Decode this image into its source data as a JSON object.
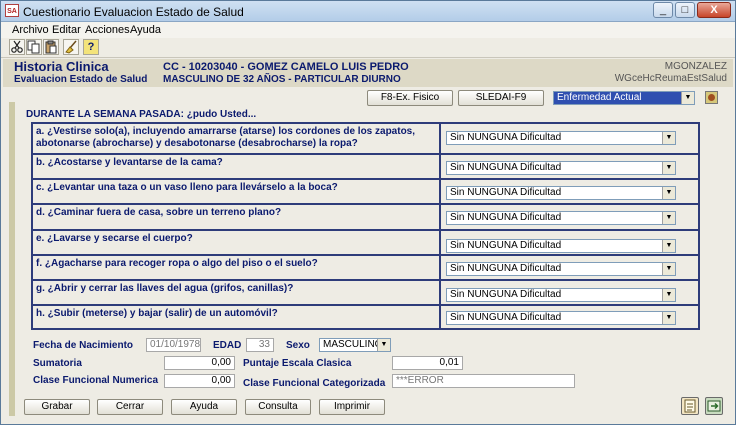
{
  "window": {
    "title": "Cuestionario Evaluacion Estado de Salud",
    "icon_text": "SA"
  },
  "title_buttons": {
    "minimize": "_",
    "maximize": "□",
    "close": "X"
  },
  "menu": {
    "archivo": "Archivo",
    "editar": "Editar",
    "acciones": "Acciones",
    "ayuda": "Ayuda"
  },
  "toolbar": {
    "cut_icon": "cut-icon",
    "copy_icon": "copy-icon",
    "paste_icon": "paste-icon",
    "clean_icon": "broom-icon",
    "help_icon": "help-icon",
    "help_glyph": "?"
  },
  "header": {
    "title": "Historia Clinica",
    "subtitle": "Evaluacion Estado de Salud",
    "patient_line": "CC - 10203040 - GOMEZ CAMELO LUIS PEDRO",
    "patient_detail": "MASCULINO DE 32 AÑOS - PARTICULAR DIURNO",
    "user": "MGONZALEZ",
    "form_id": "WGceHcReumaEstSalud"
  },
  "nav": {
    "exam_button": "F8-Ex. Fisico",
    "sledai_button": "SLEDAI-F9",
    "section_select": "Enfermedad Actual"
  },
  "section_title": "DURANTE LA SEMANA PASADA: ¿pudo Usted...",
  "questions": [
    {
      "label": "a. ¿Vestirse solo(a), incluyendo amarrarse (atarse) los cordones de los zapatos, abotonarse (abrocharse) y desabotonarse (desabrocharse) la ropa?",
      "value": "Sin NUNGUNA Dificultad"
    },
    {
      "label": "b. ¿Acostarse y levantarse de la cama?",
      "value": "Sin NUNGUNA Dificultad"
    },
    {
      "label": "c. ¿Levantar una taza o un vaso lleno para llevárselo a la boca?",
      "value": "Sin NUNGUNA Dificultad"
    },
    {
      "label": "d. ¿Caminar fuera de casa, sobre un terreno plano?",
      "value": "Sin NUNGUNA Dificultad"
    },
    {
      "label": "e. ¿Lavarse y secarse el cuerpo?",
      "value": "Sin NUNGUNA Dificultad"
    },
    {
      "label": "f. ¿Agacharse para recoger ropa o algo del piso o el suelo?",
      "value": "Sin NUNGUNA Dificultad"
    },
    {
      "label": "g. ¿Abrir y cerrar las llaves del agua (grifos, canillas)?",
      "value": "Sin NUNGUNA Dificultad"
    },
    {
      "label": "h. ¿Subir (meterse) y bajar (salir) de un automóvil?",
      "value": "Sin NUNGUNA Dificultad"
    }
  ],
  "fields": {
    "birth_label": "Fecha de Nacimiento",
    "birth_value": "01/10/1978",
    "age_label": "EDAD",
    "age_value": "33",
    "sex_label": "Sexo",
    "sex_value": "MASCULINO",
    "sum_label": "Sumatoria",
    "sum_value": "0,00",
    "score_label": "Puntaje Escala Clasica",
    "score_value": "0,01",
    "func_num_label": "Clase Funcional Numerica",
    "func_num_value": "0,00",
    "func_cat_label": "Clase Funcional Categorizada",
    "func_cat_value": "***ERROR"
  },
  "actions": {
    "save": "Grabar",
    "close": "Cerrar",
    "help": "Ayuda",
    "query": "Consulta",
    "print": "Imprimir"
  }
}
